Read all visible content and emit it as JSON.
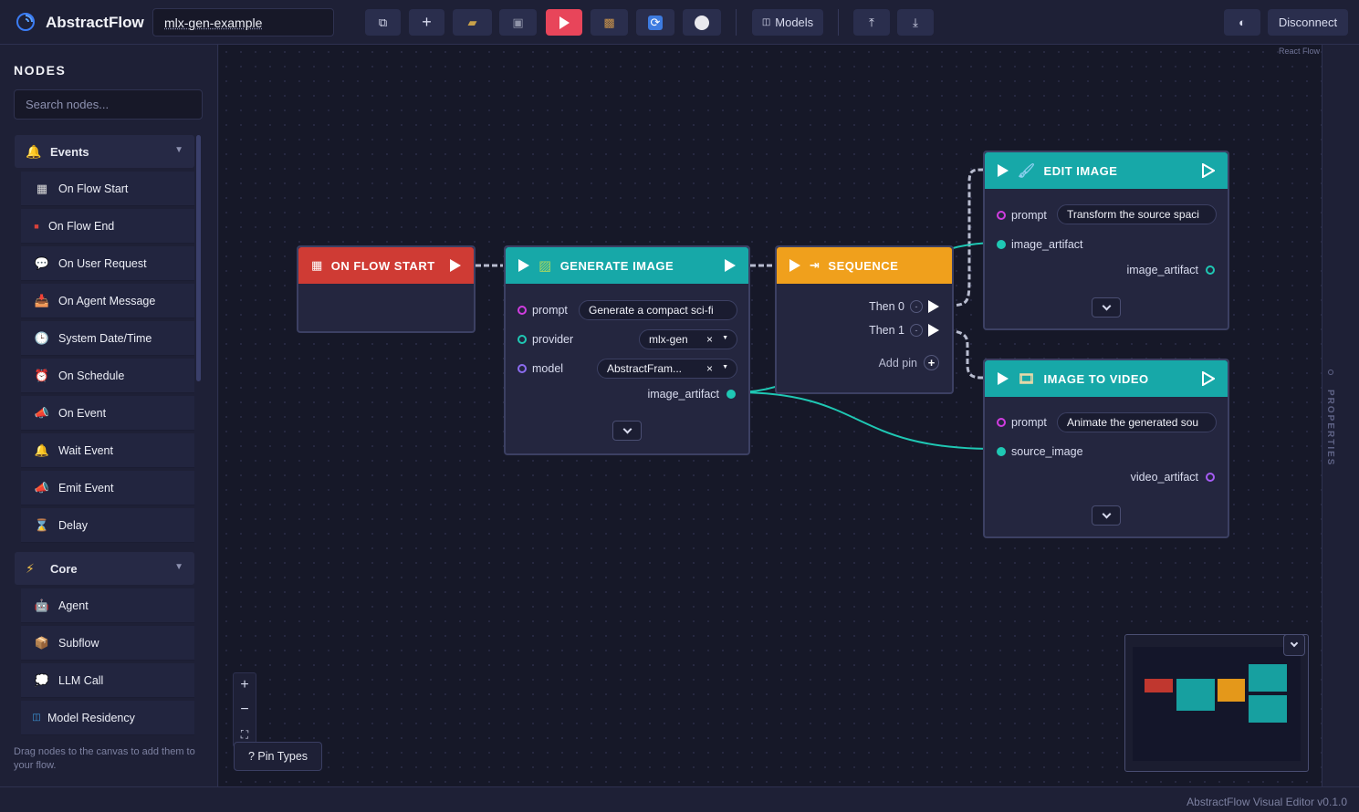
{
  "app": {
    "title": "AbstractFlow",
    "flow_name": "mlx-gen-example"
  },
  "toolbar": {
    "models_label": "Models",
    "disconnect_label": "Disconnect"
  },
  "sidebar": {
    "title": "NODES",
    "search_placeholder": "Search nodes...",
    "categories": [
      {
        "label": "Events",
        "icon": "bell-icon",
        "items": [
          {
            "label": "On Flow Start",
            "icon": "checkered-flag-icon"
          },
          {
            "label": "On Flow End",
            "icon": "stop-square-icon"
          },
          {
            "label": "On User Request",
            "icon": "speech-bubble-icon"
          },
          {
            "label": "On Agent Message",
            "icon": "inbox-tray-icon"
          },
          {
            "label": "System Date/Time",
            "icon": "clock-icon"
          },
          {
            "label": "On Schedule",
            "icon": "alarm-clock-icon"
          },
          {
            "label": "On Event",
            "icon": "megaphone-icon"
          },
          {
            "label": "Wait Event",
            "icon": "bell-icon"
          },
          {
            "label": "Emit Event",
            "icon": "megaphone-icon"
          },
          {
            "label": "Delay",
            "icon": "hourglass-icon"
          }
        ]
      },
      {
        "label": "Core",
        "icon": "lightning-icon",
        "items": [
          {
            "label": "Agent",
            "icon": "robot-icon"
          },
          {
            "label": "Subflow",
            "icon": "package-icon"
          },
          {
            "label": "LLM Call",
            "icon": "thought-bubble-icon"
          },
          {
            "label": "Model Residency",
            "icon": "chip-icon"
          }
        ]
      }
    ],
    "drag_hint": "Drag nodes to the canvas to add them to your flow."
  },
  "canvas": {
    "attribution": "React Flow",
    "properties_label": "PROPERTIES",
    "pin_types_label": "? Pin Types"
  },
  "nodes": {
    "flow_start": {
      "title": "ON FLOW START",
      "color": "#cf3b34"
    },
    "generate_image": {
      "title": "GENERATE IMAGE",
      "color": "#17a8a8",
      "inputs": [
        {
          "label": "prompt",
          "value": "Generate a compact sci-fi"
        },
        {
          "label": "provider",
          "value": "mlx-gen"
        },
        {
          "label": "model",
          "value": "AbstractFram..."
        }
      ],
      "output": "image_artifact"
    },
    "sequence": {
      "title": "SEQUENCE",
      "color": "#f0a01c",
      "then0": "Then 0",
      "then1": "Then 1",
      "add_pin": "Add pin"
    },
    "edit_image": {
      "title": "EDIT IMAGE",
      "color": "#17a8a8",
      "prompt_label": "prompt",
      "prompt_value": "Transform the source spaci",
      "input2": "image_artifact",
      "output": "image_artifact"
    },
    "image_to_video": {
      "title": "IMAGE TO VIDEO",
      "color": "#17a8a8",
      "prompt_label": "prompt",
      "prompt_value": "Animate the generated sou",
      "input2": "source_image",
      "output": "video_artifact"
    }
  },
  "status": {
    "version": "AbstractFlow Visual Editor v0.1.0"
  },
  "colors": {
    "teal": "#1fc8b4",
    "string_pin": "#d03de0",
    "provider_pin": "#1fc8b4",
    "model_pin": "#8c6cf0",
    "video_pin": "#a65cf5",
    "run_button": "#e8455a"
  }
}
